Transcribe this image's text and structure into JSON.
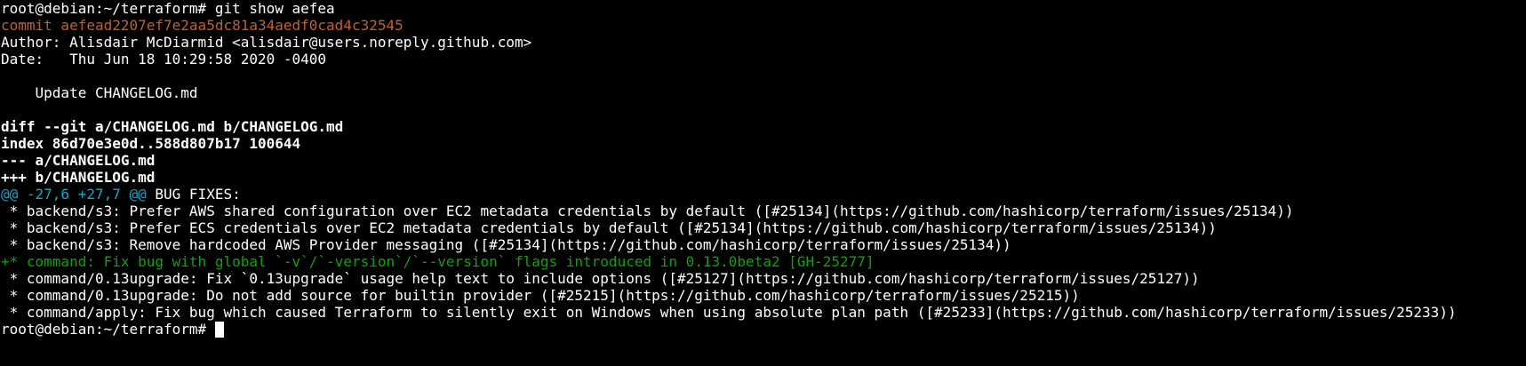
{
  "terminal": {
    "prompt_command": "root@debian:~/terraform# git show aefea",
    "commit": "commit aefead2207ef7e2aa5dc81a34aedf0cad4c32545",
    "author": "Author: Alisdair McDiarmid <alisdair@users.noreply.github.com>",
    "date": "Date:   Thu Jun 18 10:29:58 2020 -0400",
    "blank1": "",
    "message": "    Update CHANGELOG.md",
    "blank2": "",
    "diff_header": "diff --git a/CHANGELOG.md b/CHANGELOG.md",
    "index": "index 86d70e3e0d..588d807b17 100644",
    "minus_file": "--- a/CHANGELOG.md",
    "plus_file": "+++ b/CHANGELOG.md",
    "hunk_marker": "@@ -27,6 +27,7 @@",
    "hunk_context": " BUG FIXES:",
    "lines": [
      " * backend/s3: Prefer AWS shared configuration over EC2 metadata credentials by default ([#25134](https://github.com/hashicorp/terraform/issues/25134))",
      " * backend/s3: Prefer ECS credentials over EC2 metadata credentials by default ([#25134](https://github.com/hashicorp/terraform/issues/25134))",
      " * backend/s3: Remove hardcoded AWS Provider messaging ([#25134](https://github.com/hashicorp/terraform/issues/25134))"
    ],
    "added_line": "+* command: Fix bug with global `-v`/`-version`/`--version` flags introduced in 0.13.0beta2 [GH-25277]",
    "lines_after": [
      " * command/0.13upgrade: Fix `0.13upgrade` usage help text to include options ([#25127](https://github.com/hashicorp/terraform/issues/25127))",
      " * command/0.13upgrade: Do not add source for builtin provider ([#25215](https://github.com/hashicorp/terraform/issues/25215))",
      " * command/apply: Fix bug which caused Terraform to silently exit on Windows when using absolute plan path ([#25233](https://github.com/hashicorp/terraform/issues/25233))"
    ],
    "final_prompt": "root@debian:~/terraform# "
  },
  "colors": {
    "background": "#000000",
    "foreground": "#ffffff",
    "commit": "#c0622a",
    "hunk": "#11a8cd",
    "added": "#13a10e"
  }
}
